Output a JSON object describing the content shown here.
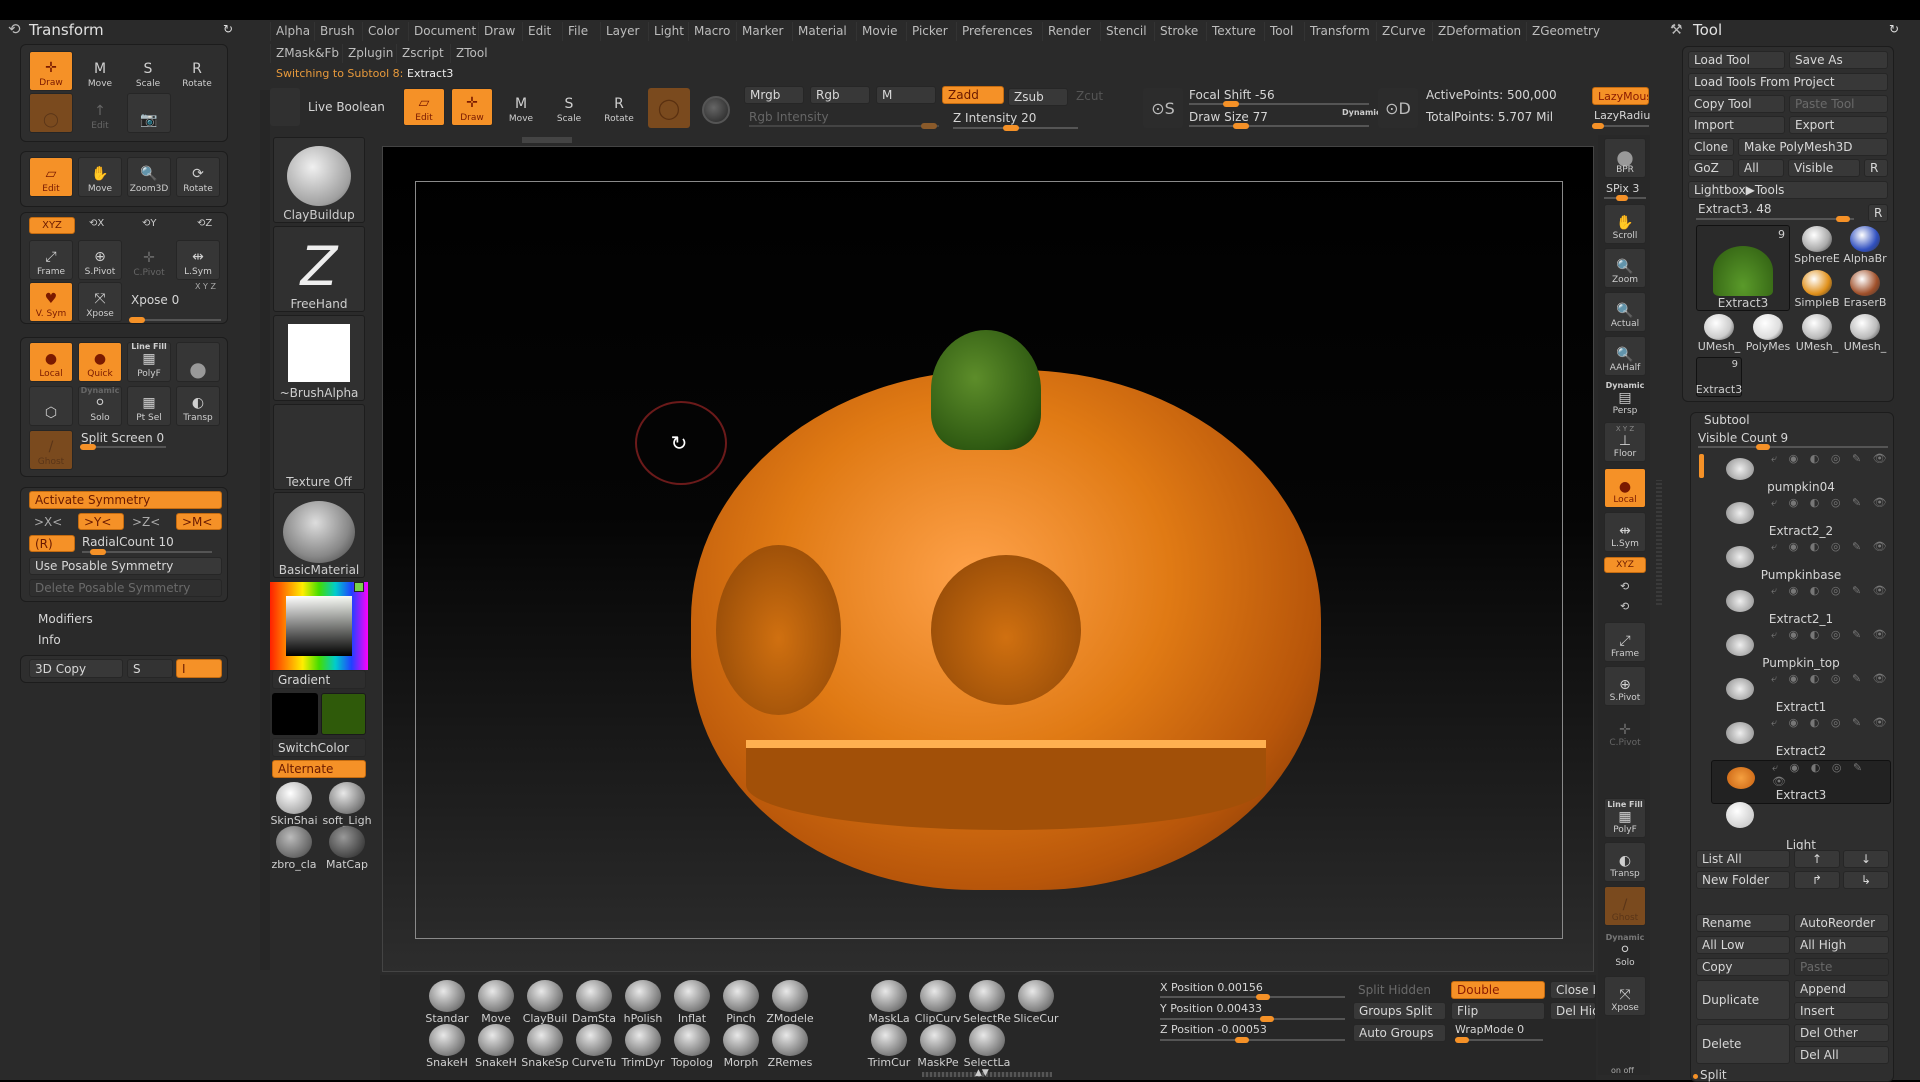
{
  "left_panel": {
    "title": "Transform",
    "row1": [
      {
        "label": "Draw",
        "icon": "draw-icon",
        "active": true
      },
      {
        "label": "Move",
        "icon": "move-icon",
        "badge": "M"
      },
      {
        "label": "Scale",
        "icon": "scale-icon",
        "badge": "S"
      },
      {
        "label": "Rotate",
        "icon": "rotate-icon",
        "badge": "R"
      }
    ],
    "row2": [
      {
        "label": "",
        "icon": "gyro-icon"
      },
      {
        "label": "Edit",
        "icon": "edit-arrow-icon"
      },
      {
        "label": "",
        "icon": "camera-icon"
      }
    ],
    "nav": [
      {
        "label": "Edit",
        "active": true
      },
      {
        "label": "Move"
      },
      {
        "label": "Zoom3D"
      },
      {
        "label": "Rotate"
      }
    ],
    "axes": [
      "XYZ",
      "X",
      "Y",
      "Z"
    ],
    "pivots": [
      "Frame",
      "S.Pivot",
      "C.Pivot",
      "L.Sym"
    ],
    "xyz_small": "X Y Z",
    "vsym": "V. Sym",
    "xpose": "Xpose",
    "xpose_slider": {
      "label": "Xpose 0",
      "value": 0
    },
    "display": [
      {
        "label": "Local",
        "active": true
      },
      {
        "label": "Quick",
        "active": true
      },
      {
        "label": "PolyF",
        "top": "Line Fill"
      },
      {
        "label": ""
      }
    ],
    "display2": [
      {
        "label": ""
      },
      {
        "label": "Solo",
        "top": "Dynamic"
      },
      {
        "label": "Pt Sel"
      },
      {
        "label": "Transp"
      }
    ],
    "ghost": "Ghost",
    "split_screen": {
      "label": "Split Screen 0",
      "value": 0
    },
    "symmetry": {
      "activate": "Activate Symmetry",
      "axes": [
        {
          "label": ">X<",
          "active": false
        },
        {
          "label": ">Y<",
          "active": true
        },
        {
          "label": ">Z<",
          "active": false
        },
        {
          "label": ">M<",
          "active": true
        }
      ],
      "radial": "(R)",
      "radial_count": {
        "label": "RadialCount 10",
        "value": 10
      },
      "use_posable": "Use Posable Symmetry",
      "delete_posable": "Delete Posable Symmetry"
    },
    "modifiers": "Modifiers",
    "info": "Info",
    "copy3d": {
      "label": "3D Copy",
      "s": "S",
      "i": "I"
    }
  },
  "menubar": {
    "row1": [
      "Alpha",
      "Brush",
      "Color",
      "Document",
      "Draw",
      "Edit",
      "File",
      "Layer",
      "Light",
      "Macro",
      "Marker",
      "Material",
      "Movie",
      "Picker",
      "Preferences",
      "Render",
      "Stencil",
      "Stroke",
      "Texture",
      "Tool",
      "Transform",
      "ZCurve",
      "ZDeformation",
      "ZGeometry"
    ],
    "row2": [
      "ZMask&Fb",
      "Zplugin",
      "Zscript",
      "ZTool"
    ]
  },
  "status": {
    "prefix": "Switching to Subtool 8:",
    "value": "Extract3"
  },
  "toolbar": {
    "live_boolean": "Live Boolean",
    "modes": [
      {
        "label": "Edit",
        "active": true
      },
      {
        "label": "Draw",
        "active": true
      },
      {
        "label": "Move",
        "badge": "M"
      },
      {
        "label": "Scale",
        "badge": "S"
      },
      {
        "label": "Rotate",
        "badge": "R"
      }
    ],
    "mrgb": "Mrgb",
    "rgb": "Rgb",
    "m": "M",
    "zadd": "Zadd",
    "zsub": "Zsub",
    "zcut": "Zcut",
    "rgb_intensity": "Rgb Intensity",
    "z_intensity": {
      "label": "Z Intensity 20",
      "value": 20
    },
    "focal_shift": {
      "label": "Focal Shift -56",
      "value": -56
    },
    "draw_size": {
      "label": "Draw Size 77",
      "value": 77
    },
    "dynamic": "Dynamic",
    "active_points": "ActivePoints: 500,000",
    "total_points": "TotalPoints: 5.707 Mil",
    "lazy_mouse": "LazyMous",
    "lazy_radius": "LazyRadiu"
  },
  "shelf": {
    "brush": "ClayBuildup",
    "stroke": "FreeHand",
    "alpha": "~BrushAlpha",
    "texture": "Texture Off",
    "material": "BasicMaterial",
    "gradient": "Gradient",
    "main_color": "#000000",
    "secondary_color": "#2f5a0a",
    "switch_color": "SwitchColor",
    "alternate": "Alternate",
    "matcaps": [
      "SkinShai",
      "soft_Ligh",
      "zbro_cla",
      "MatCap"
    ]
  },
  "right_shelf": {
    "bpr": "BPR",
    "spix": {
      "label": "SPix 3",
      "value": 3
    },
    "buttons": [
      "Scroll",
      "Zoom",
      "Actual",
      "AAHalf"
    ],
    "persp": "Persp",
    "persp_top": "Dynamic",
    "floor": "Floor",
    "floor_top": "X Y Z",
    "local": "Local",
    "lsym": "L.Sym",
    "xyz": "XYZ",
    "frame": "Frame",
    "spivot": "S.Pivot",
    "cpivot": "C.Pivot",
    "polyf": "PolyF",
    "polyf_top": "Line Fill",
    "transp": "Transp",
    "ghost": "Ghost",
    "solo": "Solo",
    "solo_top": "Dynamic",
    "xpose": "Xpose",
    "onoff": "on  off"
  },
  "tool_panel": {
    "title": "Tool",
    "load_tool": "Load Tool",
    "save_as": "Save As",
    "load_from_project": "Load Tools From Project",
    "copy_tool": "Copy Tool",
    "paste_tool": "Paste Tool",
    "import": "Import",
    "export": "Export",
    "clone": "Clone",
    "make_polymesh": "Make PolyMesh3D",
    "goz": "GoZ",
    "all": "All",
    "visible": "Visible",
    "r": "R",
    "lightbox": "Lightbox▶Tools",
    "current": {
      "label": "Extract3. 48",
      "value": 48
    },
    "main_thumb": {
      "label": "Extract3",
      "count": "9"
    },
    "thumbs": [
      "SphereE",
      "AlphaBr",
      "SimpleB",
      "EraserB",
      "UMesh_",
      "PolyMes",
      "UMesh_",
      "UMesh_"
    ],
    "small_thumb": {
      "label": "Extract3",
      "count": "9"
    }
  },
  "subtool": {
    "title": "Subtool",
    "visible_count": {
      "label": "Visible Count 9",
      "value": 9
    },
    "items": [
      {
        "name": "pumpkin04"
      },
      {
        "name": "Extract2_2"
      },
      {
        "name": "Pumpkinbase"
      },
      {
        "name": "Extract2_1"
      },
      {
        "name": "Pumpkin_top"
      },
      {
        "name": "Extract1"
      },
      {
        "name": "Extract2"
      },
      {
        "name": "Extract3",
        "selected": true
      },
      {
        "name": "Light"
      }
    ],
    "list_all": "List All",
    "new_folder": "New Folder",
    "rename": "Rename",
    "auto_reorder": "AutoReorder",
    "all_low": "All Low",
    "all_high": "All High",
    "copy": "Copy",
    "paste": "Paste",
    "duplicate": "Duplicate",
    "append": "Append",
    "insert": "Insert",
    "delete": "Delete",
    "del_other": "Del Other",
    "del_all": "Del All",
    "split": "Split"
  },
  "bottom": {
    "brushes_row1": [
      "Standar",
      "Move",
      "ClayBuil",
      "DamSta",
      "hPolish",
      "Inflat",
      "Pinch",
      "ZModele"
    ],
    "brushes_row2": [
      "SnakeH",
      "SnakeH",
      "SnakeSp",
      "CurveTu",
      "TrimDyr",
      "Topolog",
      "Morph",
      "ZRemes"
    ],
    "selection_row1": [
      "MaskLa",
      "ClipCurv",
      "SelectRe",
      "SliceCur"
    ],
    "selection_row2": [
      "TrimCur",
      "MaskPe",
      "SelectLa"
    ],
    "x_position": {
      "label": "X Position 0.00156",
      "value": 0.00156
    },
    "y_position": {
      "label": "Y Position 0.00433",
      "value": 0.00433
    },
    "z_position": {
      "label": "Z Position -0.00053",
      "value": -0.00053
    },
    "split_hidden": "Split Hidden",
    "groups_split": "Groups Split",
    "auto_groups": "Auto Groups",
    "double": "Double",
    "flip": "Flip",
    "wrapmode": {
      "label": "WrapMode 0",
      "value": 0
    },
    "close_holes": "Close H",
    "del_hidden": "Del Hidd"
  },
  "colors": {
    "accent": "#f59127",
    "panel": "#2e2e2e",
    "bg": "#2a2a2a"
  }
}
